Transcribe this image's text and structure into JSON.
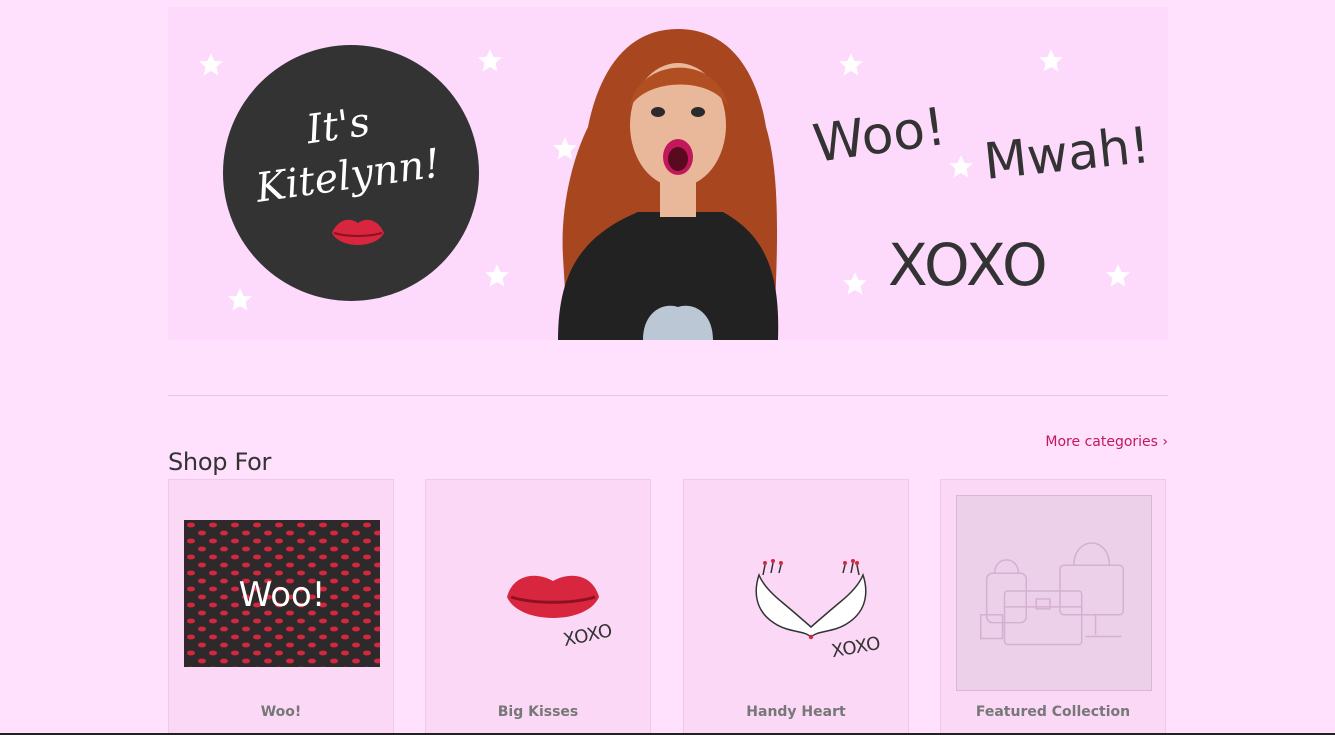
{
  "banner": {
    "badge_line1": "It's",
    "badge_line2": "Kitelynn!",
    "word1": "Woo!",
    "word2": "Mwah!",
    "word3": "XOXO"
  },
  "section": {
    "title": "Shop For",
    "more_link": "More categories ›"
  },
  "cards": [
    {
      "label": "Woo!",
      "thumb_text": "Woo!"
    },
    {
      "label": "Big Kisses",
      "thumb_text": "XOXO"
    },
    {
      "label": "Handy Heart",
      "thumb_text": "XOXO"
    },
    {
      "label": "Featured Collection"
    }
  ],
  "colors": {
    "background": "#ffe0fd",
    "accent": "#c2185b",
    "lip_red": "#d7263d",
    "badge_dark": "#333333"
  }
}
